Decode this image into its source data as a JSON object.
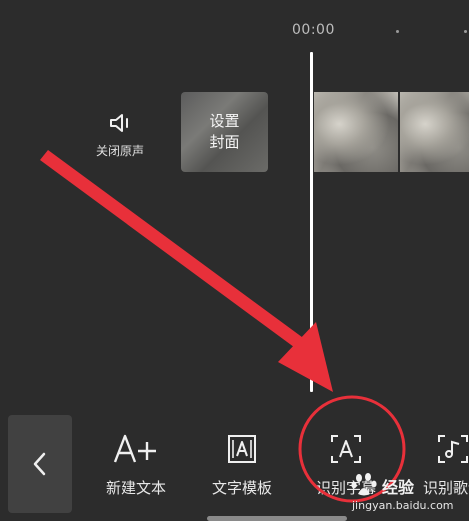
{
  "timeline": {
    "timecode": "00:00"
  },
  "mute": {
    "label": "关闭原声",
    "icon": "speaker-icon"
  },
  "cover": {
    "line1": "设置",
    "line2": "封面"
  },
  "toolbar": {
    "back_icon": "chevron-left-icon",
    "tools": [
      {
        "label": "新建文本",
        "icon": "text-add-icon"
      },
      {
        "label": "文字模板",
        "icon": "text-template-icon"
      },
      {
        "label": "识别字幕",
        "icon": "recognize-subtitle-icon"
      },
      {
        "label": "识别歌词",
        "icon": "recognize-lyrics-icon"
      }
    ]
  },
  "annotation": {
    "color": "#e8303a"
  },
  "watermark": {
    "brand": "经验",
    "site": "jingyan.baidu.com"
  },
  "colors": {
    "background": "#2c2c2c",
    "back_button": "#414141",
    "playhead": "#ffffff"
  }
}
